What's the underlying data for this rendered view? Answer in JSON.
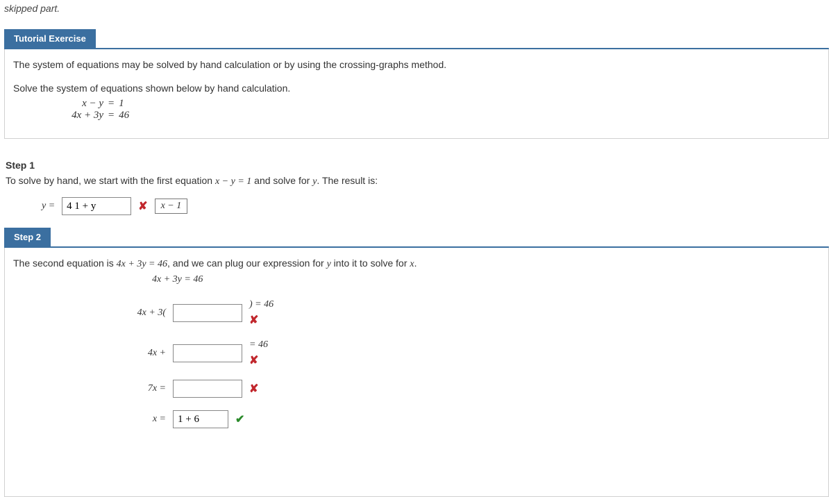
{
  "intro": "skipped part.",
  "tutorial": {
    "tab": "Tutorial Exercise",
    "line1": "The system of equations may be solved by hand calculation or by using the crossing-graphs method.",
    "line2": "Solve the system of equations shown below by hand calculation.",
    "eq1_left": "x − y",
    "eq1_eq": "=",
    "eq1_right": "1",
    "eq2_left": "4x + 3y",
    "eq2_eq": "=",
    "eq2_right": "46"
  },
  "step1": {
    "title": "Step 1",
    "text_a": "To solve by hand, we start with the first equation ",
    "text_eq": "x − y = 1",
    "text_b": " and solve for ",
    "text_var": "y",
    "text_c": ". The result is:",
    "ylabel": "y = ",
    "answer_value": "4 1 + y",
    "wrong": "✘",
    "hint": "x − 1"
  },
  "step2": {
    "tab": "Step 2",
    "text_a": "The second equation is ",
    "text_eq": "4x + 3y = 46",
    "text_b": ", and we can plug our expression for ",
    "text_var": "y",
    "text_c": " into it to solve for ",
    "text_var2": "x",
    "text_d": ".",
    "eqline": "4x + 3y = 46",
    "r1_left": "4x + 3(",
    "r1_right": ") = 46",
    "r2_left": "4x +",
    "r2_right": "= 46",
    "r3_left": "7x =",
    "r4_left": "x =",
    "r4_value": "1 + 6",
    "wrong": "✘",
    "correct": "✔"
  }
}
